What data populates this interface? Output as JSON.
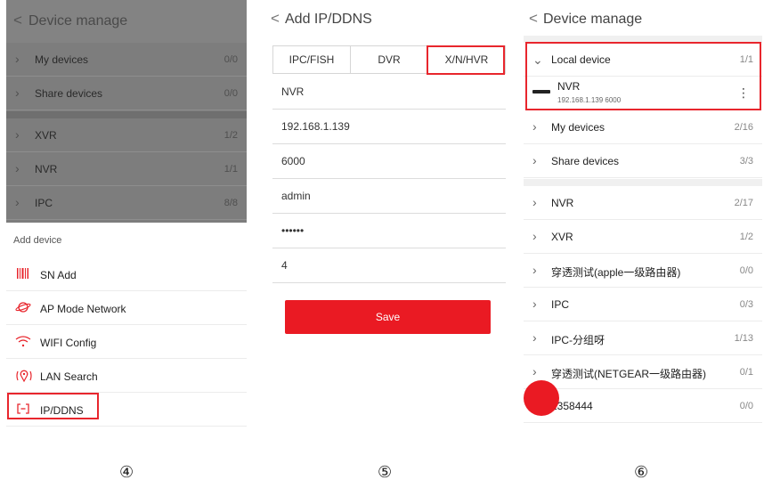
{
  "panel1": {
    "header_back": "<",
    "title": "Device manage",
    "rows": [
      {
        "label": "My devices",
        "count": "0/0"
      },
      {
        "label": "Share devices",
        "count": "0/0"
      },
      {
        "label": "XVR",
        "count": "1/2"
      },
      {
        "label": "NVR",
        "count": "1/1"
      },
      {
        "label": "IPC",
        "count": "8/8"
      }
    ],
    "sheet_title": "Add device",
    "options": [
      {
        "label": "SN Add",
        "icon": "barcode-icon"
      },
      {
        "label": "AP Mode Network",
        "icon": "planet-icon"
      },
      {
        "label": "WIFI Config",
        "icon": "wifi-icon"
      },
      {
        "label": "LAN Search",
        "icon": "location-icon"
      },
      {
        "label": "IP/DDNS",
        "icon": "ip-ddns-icon"
      }
    ]
  },
  "panel2": {
    "header_back": "<",
    "title": "Add IP/DDNS",
    "tabs": [
      "IPC/FISH",
      "DVR",
      "X/N/HVR"
    ],
    "fields": [
      "NVR",
      "192.168.1.139",
      "6000",
      "admin",
      "••••••",
      "4"
    ],
    "save_label": "Save"
  },
  "panel3": {
    "header_back": "<",
    "title": "Device manage",
    "local": {
      "label": "Local device",
      "count": "1/1"
    },
    "device": {
      "name": "NVR",
      "address": "192.168.1.139  6000"
    },
    "rows_a": [
      {
        "label": "My devices",
        "count": "2/16"
      },
      {
        "label": "Share devices",
        "count": "3/3"
      }
    ],
    "rows_b": [
      {
        "label": "NVR",
        "count": "2/17"
      },
      {
        "label": "XVR",
        "count": "1/2"
      },
      {
        "label": "穿透测试(apple一级路由器)",
        "count": "0/0"
      },
      {
        "label": "IPC",
        "count": "0/3"
      },
      {
        "label": "IPC-分组呀",
        "count": "1/13"
      },
      {
        "label": "穿透测试(NETGEAR一级路由器)",
        "count": "0/1"
      },
      {
        "label": "2358444",
        "count": "0/0"
      }
    ]
  },
  "captions": [
    "④",
    "⑤",
    "⑥"
  ],
  "colors": {
    "accent": "#e8262d",
    "overlay": "#7d7d7d"
  }
}
